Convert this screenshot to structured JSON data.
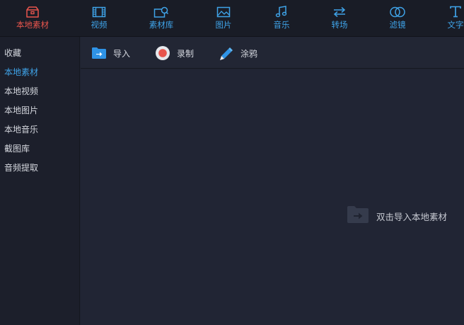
{
  "colors": {
    "accent": "#3fa3e8",
    "active": "#e8554d",
    "text": "#d4d7de",
    "background": "#1f2330"
  },
  "topnav": {
    "tabs": [
      {
        "label": "本地素材",
        "icon": "folder-box-icon",
        "active": true
      },
      {
        "label": "视频",
        "icon": "film-icon",
        "active": false
      },
      {
        "label": "素材库",
        "icon": "library-icon",
        "active": false
      },
      {
        "label": "图片",
        "icon": "image-icon",
        "active": false
      },
      {
        "label": "音乐",
        "icon": "music-note-icon",
        "active": false
      },
      {
        "label": "转场",
        "icon": "transition-arrows-icon",
        "active": false
      },
      {
        "label": "滤镜",
        "icon": "filter-circles-icon",
        "active": false
      },
      {
        "label": "文字",
        "icon": "text-icon",
        "active": false
      }
    ]
  },
  "sidebar": {
    "items": [
      {
        "label": "收藏",
        "active": false
      },
      {
        "label": "本地素材",
        "active": true
      },
      {
        "label": "本地视频",
        "active": false
      },
      {
        "label": "本地图片",
        "active": false
      },
      {
        "label": "本地音乐",
        "active": false
      },
      {
        "label": "截图库",
        "active": false
      },
      {
        "label": "音频提取",
        "active": false
      }
    ]
  },
  "toolbar": {
    "import_label": "导入",
    "record_label": "录制",
    "doodle_label": "涂鸦"
  },
  "main": {
    "empty_hint": "双击导入本地素材"
  }
}
